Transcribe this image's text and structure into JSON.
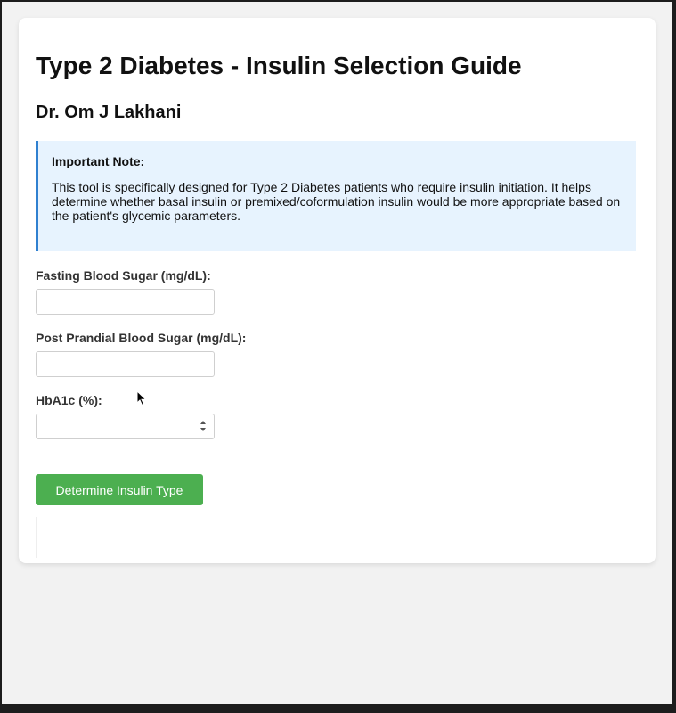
{
  "page": {
    "title": "Type 2 Diabetes - Insulin Selection Guide",
    "author": "Dr. Om J Lakhani"
  },
  "note": {
    "title": "Important Note:",
    "body": "This tool is specifically designed for Type 2 Diabetes patients who require insulin initiation. It helps determine whether basal insulin or premixed/coformulation insulin would be more appropriate based on the patient's glycemic parameters."
  },
  "form": {
    "fasting": {
      "label": "Fasting Blood Sugar (mg/dL):",
      "value": ""
    },
    "post_prandial": {
      "label": "Post Prandial Blood Sugar (mg/dL):",
      "value": ""
    },
    "hba1c": {
      "label": "HbA1c (%):",
      "value": ""
    },
    "submit_label": "Determine Insulin Type"
  },
  "colors": {
    "button": "#4caf50",
    "note_background": "#e7f3fe",
    "note_border": "#2f80d0",
    "page_background": "#f2f2f2"
  },
  "icons": {
    "pointer": "mouse-cursor-icon",
    "number_spinner": "spinner-arrows-icon"
  }
}
